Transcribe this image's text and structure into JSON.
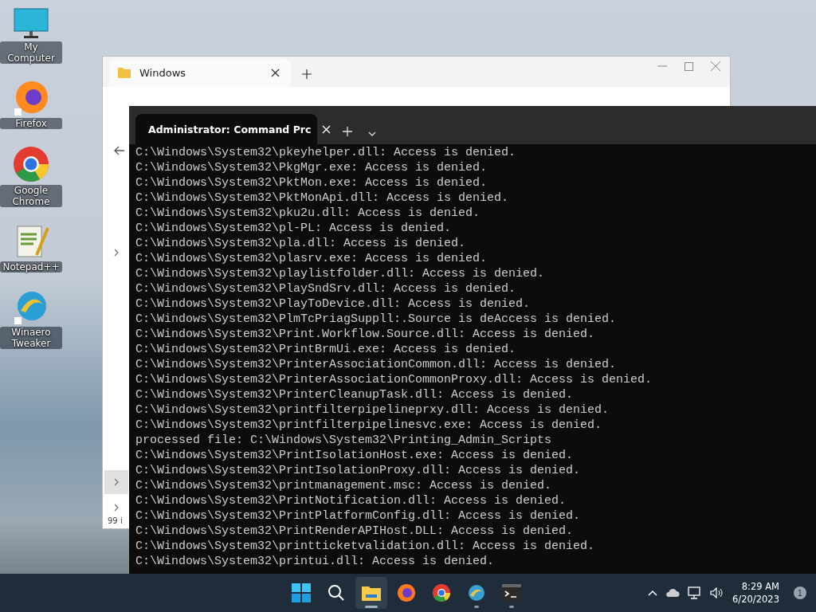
{
  "desktop_icons": [
    {
      "label": "My Computer",
      "kind": "computer"
    },
    {
      "label": "Firefox",
      "kind": "firefox"
    },
    {
      "label": "Google Chrome",
      "kind": "chrome"
    },
    {
      "label": "Notepad++",
      "kind": "notepad"
    },
    {
      "label": "Winaero Tweaker",
      "kind": "winaero"
    }
  ],
  "explorer": {
    "tab": "Windows",
    "status": "99 i",
    "sidebar_rows": [
      {
        "selected": false
      },
      {
        "selected": true
      },
      {
        "selected": false
      }
    ]
  },
  "terminal": {
    "tab": "Administrator:  Command Prc",
    "lines": [
      "C:\\Windows\\System32\\pkeyhelper.dll: Access is denied.",
      "C:\\Windows\\System32\\PkgMgr.exe: Access is denied.",
      "C:\\Windows\\System32\\PktMon.exe: Access is denied.",
      "C:\\Windows\\System32\\PktMonApi.dll: Access is denied.",
      "C:\\Windows\\System32\\pku2u.dll: Access is denied.",
      "C:\\Windows\\System32\\pl-PL: Access is denied.",
      "C:\\Windows\\System32\\pla.dll: Access is denied.",
      "C:\\Windows\\System32\\plasrv.exe: Access is denied.",
      "C:\\Windows\\System32\\playlistfolder.dll: Access is denied.",
      "C:\\Windows\\System32\\PlaySndSrv.dll: Access is denied.",
      "C:\\Windows\\System32\\PlayToDevice.dll: Access is denied.",
      "C:\\Windows\\System32\\PlmTcPriagSuppll:.Source is deAccess is denied.",
      "C:\\Windows\\System32\\Print.Workflow.Source.dll: Access is denied.",
      "C:\\Windows\\System32\\PrintBrmUi.exe: Access is denied.",
      "C:\\Windows\\System32\\PrinterAssociationCommon.dll: Access is denied.",
      "C:\\Windows\\System32\\PrinterAssociationCommonProxy.dll: Access is denied.",
      "C:\\Windows\\System32\\PrinterCleanupTask.dll: Access is denied.",
      "C:\\Windows\\System32\\printfilterpipelineprxy.dll: Access is denied.",
      "C:\\Windows\\System32\\printfilterpipelinesvc.exe: Access is denied.",
      "processed file: C:\\Windows\\System32\\Printing_Admin_Scripts",
      "C:\\Windows\\System32\\PrintIsolationHost.exe: Access is denied.",
      "C:\\Windows\\System32\\PrintIsolationProxy.dll: Access is denied.",
      "C:\\Windows\\System32\\printmanagement.msc: Access is denied.",
      "C:\\Windows\\System32\\PrintNotification.dll: Access is denied.",
      "C:\\Windows\\System32\\PrintPlatformConfig.dll: Access is denied.",
      "C:\\Windows\\System32\\PrintRenderAPIHost.DLL: Access is denied.",
      "C:\\Windows\\System32\\printticketvalidation.dll: Access is denied.",
      "C:\\Windows\\System32\\printui.dll: Access is denied."
    ]
  },
  "taskbar": {
    "apps": [
      {
        "kind": "start",
        "selected": false
      },
      {
        "kind": "search",
        "selected": false
      },
      {
        "kind": "explorer",
        "selected": true
      },
      {
        "kind": "firefox",
        "selected": false
      },
      {
        "kind": "chrome",
        "selected": false
      },
      {
        "kind": "winaero",
        "selected": false
      },
      {
        "kind": "terminal",
        "selected": false
      }
    ],
    "time": "8:29 AM",
    "date": "6/20/2023",
    "notifications": "1"
  }
}
